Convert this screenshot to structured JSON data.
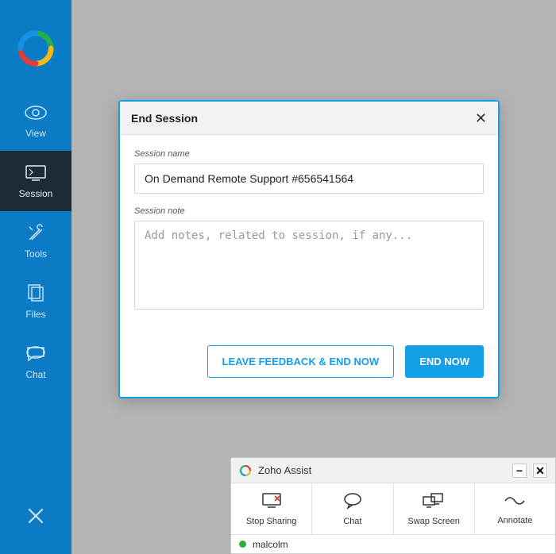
{
  "sidebar": {
    "items": [
      {
        "label": "View"
      },
      {
        "label": "Session"
      },
      {
        "label": "Tools"
      },
      {
        "label": "Files"
      },
      {
        "label": "Chat"
      }
    ]
  },
  "modal": {
    "title": "End Session",
    "session_name_label": "Session name",
    "session_name_value": "On Demand Remote Support #656541564",
    "session_note_label": "Session note",
    "session_note_placeholder": "Add notes, related to session, if any...",
    "leave_feedback_label": "LEAVE FEEDBACK & END NOW",
    "end_now_label": "END NOW"
  },
  "assist": {
    "title": "Zoho Assist",
    "actions": [
      {
        "label": "Stop Sharing"
      },
      {
        "label": "Chat"
      },
      {
        "label": "Swap Screen"
      },
      {
        "label": "Annotate"
      }
    ],
    "status_name": "malcolm"
  }
}
